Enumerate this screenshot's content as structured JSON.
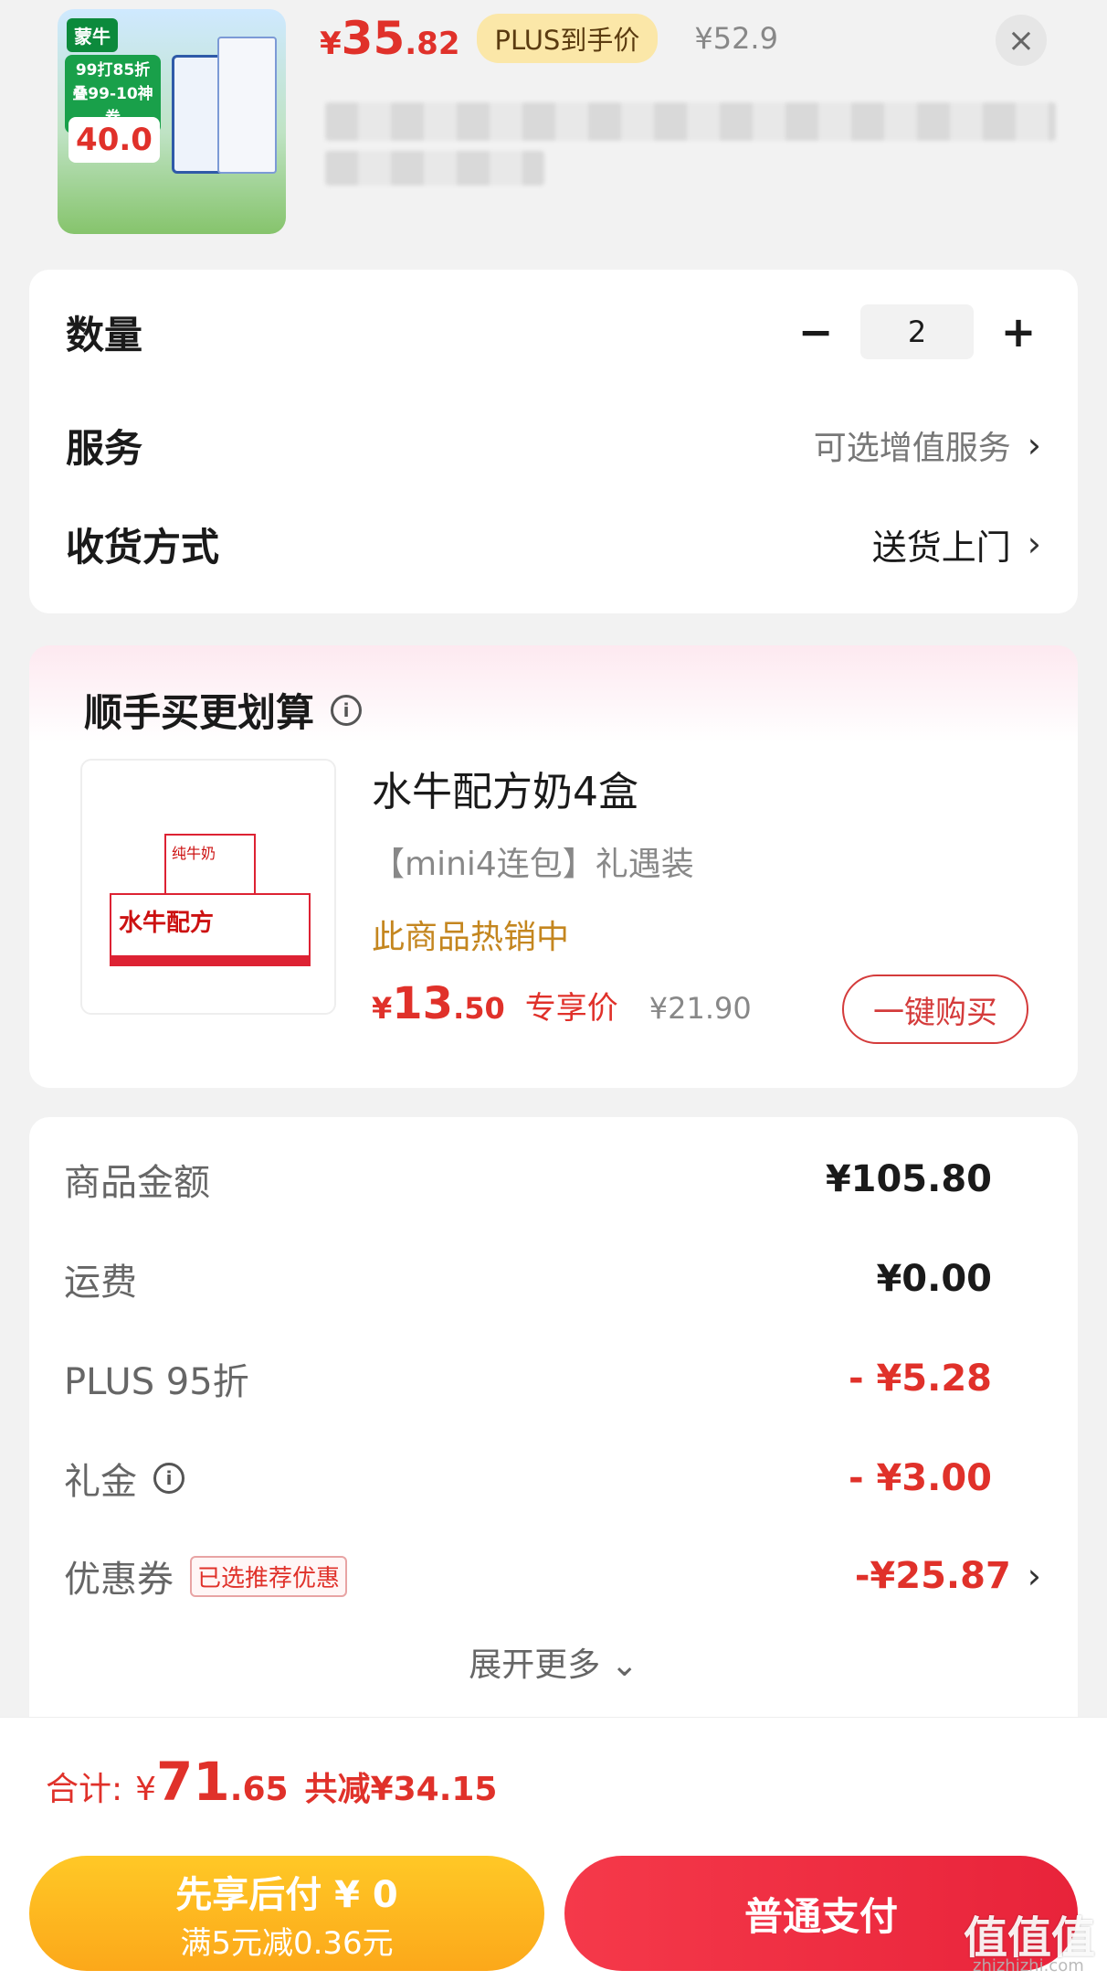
{
  "product": {
    "thumb_brand": "蒙牛",
    "thumb_promo": "99打85折 叠99-10神券",
    "thumb_coupon": "40.0",
    "price_symbol": "¥",
    "price_int": "35",
    "price_dec": ".82",
    "plus_badge": "PLUS到手价",
    "original_price": "¥52.9"
  },
  "options": {
    "quantity_label": "数量",
    "quantity_value": "2",
    "minus": "−",
    "plus": "+",
    "service_label": "服务",
    "service_value": "可选增值服务",
    "delivery_label": "收货方式",
    "delivery_value": "送货上门",
    "chevron": "›"
  },
  "upsell": {
    "title": "顺手买更划算",
    "info": "i",
    "image_text_main": "水牛配方",
    "image_text_small": "纯牛奶",
    "name": "水牛配方奶4盒",
    "subtitle": "【mini4连包】礼遇装",
    "hot": "此商品热销中",
    "price_symbol": "¥",
    "price_int": "13",
    "price_dec": ".50",
    "price_tag": "专享价",
    "original_price": "¥21.90",
    "buy_button": "一键购买"
  },
  "summary": {
    "rows": [
      {
        "label": "商品金额",
        "value": "¥105.80"
      },
      {
        "label": "运费",
        "value": "¥0.00"
      },
      {
        "label": "PLUS 95折",
        "value": "- ¥5.28"
      },
      {
        "label": "礼金",
        "value": "- ¥3.00"
      },
      {
        "label": "优惠券",
        "value": "-¥25.87",
        "tag": "已选推荐优惠"
      }
    ],
    "expand": "展开更多 ⌄"
  },
  "total": {
    "label": "合计:",
    "symbol": "¥",
    "int": "71",
    "dec": ".65",
    "saved": "共减¥34.15"
  },
  "actions": {
    "pay_later_title": "先享后付 ¥ 0",
    "pay_later_sub": "满5元减0.36元",
    "pay_normal": "普通支付"
  },
  "watermark": {
    "text": "值值值",
    "url": "zhizhizhi.com"
  },
  "icons": {
    "close": "close-icon",
    "chevron": "chevron-right-icon",
    "info": "info-icon"
  }
}
